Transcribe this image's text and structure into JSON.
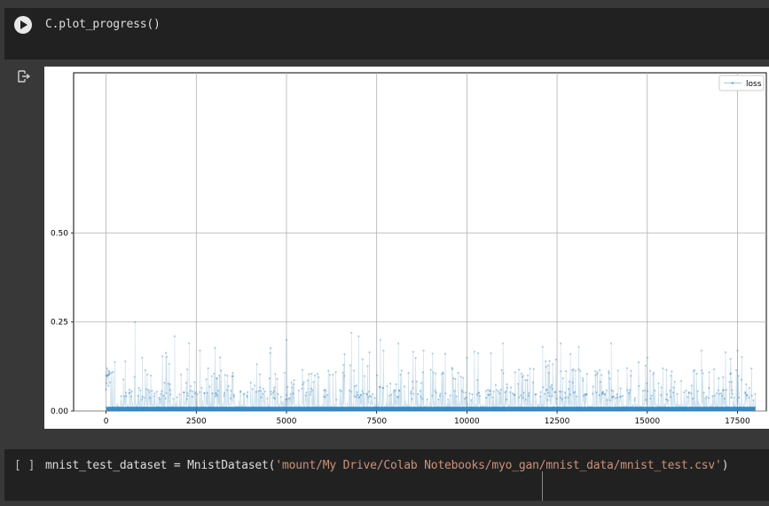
{
  "cell1": {
    "code": "C.plot_progress()",
    "run_icon": "play-icon"
  },
  "output": {
    "icon": "output-redirect-icon"
  },
  "cell2": {
    "execution_marker": "[ ]",
    "code_prefix": "mnist_test_dataset = MnistDataset(",
    "code_string": "'mount/My Drive/Colab Notebooks/myo_gan/mnist_data/mnist_test.csv'",
    "code_suffix": ")"
  },
  "chart_data": {
    "type": "line",
    "series": [
      {
        "name": "loss"
      }
    ],
    "x_ticks": [
      "0",
      "2500",
      "5000",
      "7500",
      "10000",
      "12500",
      "15000",
      "17500"
    ],
    "y_ticks": [
      "0.00",
      "0.25",
      "0.50"
    ],
    "xlim": [
      -900,
      18300
    ],
    "ylim": [
      0,
      0.95
    ],
    "grid": true,
    "legend": "top-right",
    "color": "#1f77b4",
    "x_range": [
      0,
      18000
    ],
    "x_step": 10,
    "note_values": [
      [
        0,
        0.06
      ],
      [
        800,
        0.25
      ],
      [
        1000,
        0.15
      ],
      [
        1900,
        0.21
      ],
      [
        2300,
        0.19
      ],
      [
        2600,
        0.17
      ],
      [
        5000,
        0.2
      ],
      [
        6800,
        0.22
      ],
      [
        7000,
        0.21
      ],
      [
        7600,
        0.2
      ],
      [
        8100,
        0.19
      ],
      [
        8800,
        0.17
      ],
      [
        10000,
        0.15
      ],
      [
        11000,
        0.19
      ],
      [
        12100,
        0.18
      ],
      [
        12600,
        0.19
      ],
      [
        13100,
        0.18
      ],
      [
        14000,
        0.19
      ],
      [
        15000,
        0.15
      ],
      [
        16500,
        0.17
      ],
      [
        17500,
        0.17
      ]
    ]
  }
}
